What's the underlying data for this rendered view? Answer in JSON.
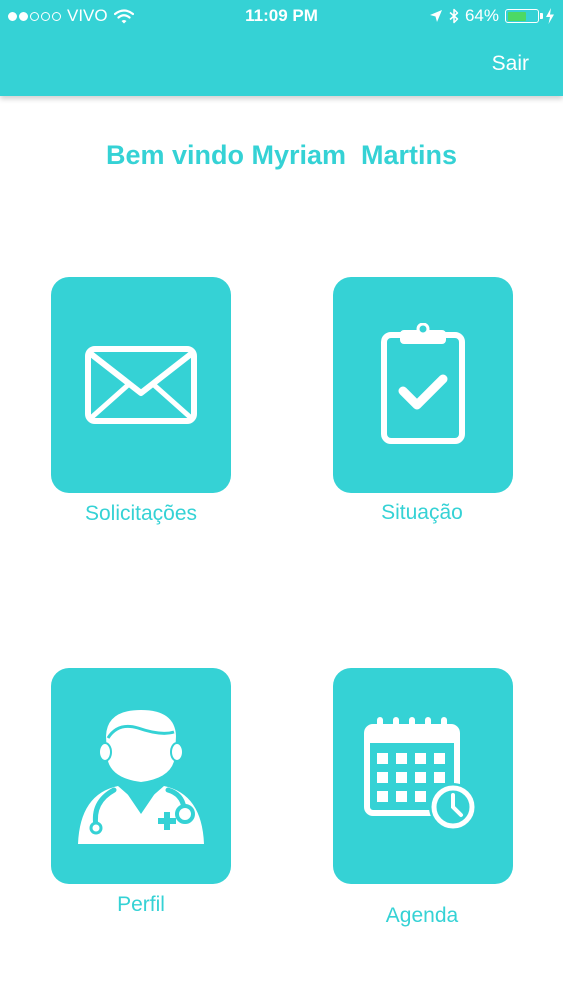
{
  "status_bar": {
    "carrier": "VIVO",
    "time": "11:09 PM",
    "battery": "64%",
    "battery_level": 0.64,
    "battery_color": "#4cd964"
  },
  "header": {
    "logout_label": "Sair",
    "color": "#35d2d5"
  },
  "welcome": "Bem vindo Myriam  Martins",
  "tiles": [
    {
      "label": "Solicitações",
      "icon": "envelope-icon"
    },
    {
      "label": "Situação",
      "icon": "clipboard-check-icon"
    },
    {
      "label": "Perfil",
      "icon": "doctor-icon"
    },
    {
      "label": "Agenda",
      "icon": "calendar-clock-icon"
    }
  ],
  "colors": {
    "accent": "#35d2d5",
    "background": "#ffffff"
  }
}
